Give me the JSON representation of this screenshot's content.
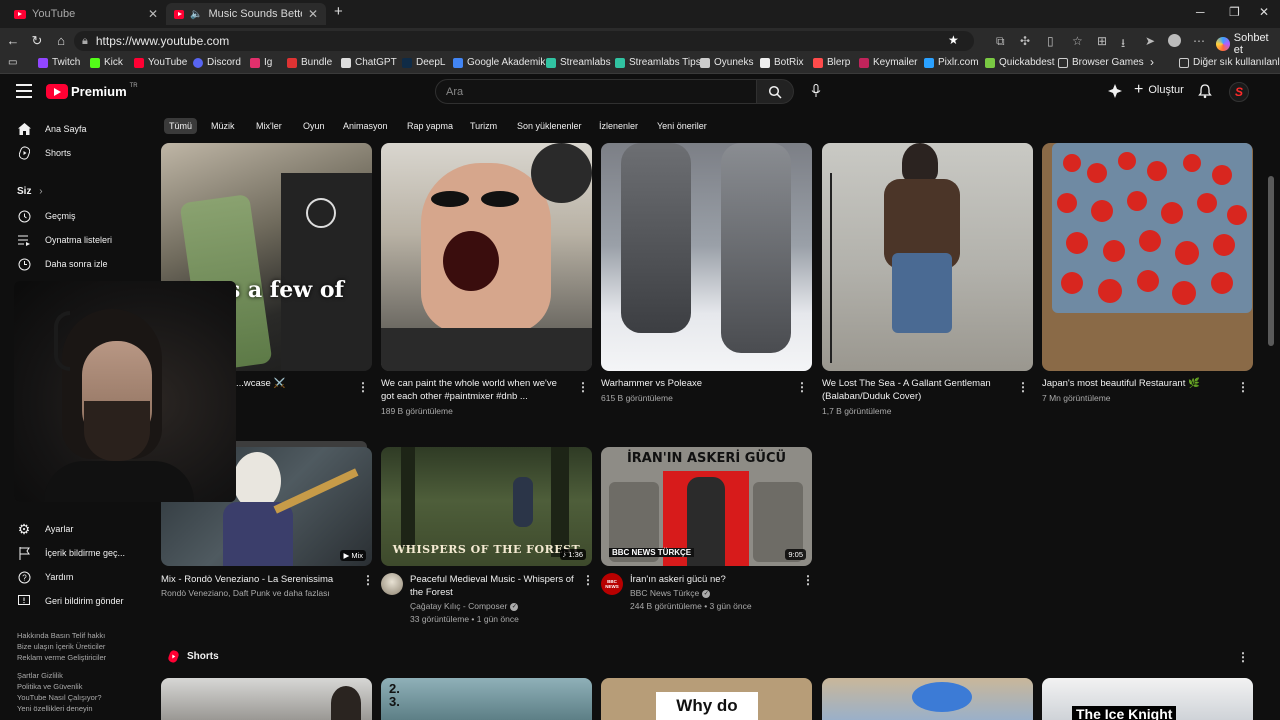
{
  "browser": {
    "tabs": [
      {
        "title": "YouTube",
        "active": false
      },
      {
        "title": "Music Sounds Better With Yo",
        "active": true
      }
    ],
    "url": "https://www.youtube.com",
    "copilot_label": "Sohbet et",
    "bookmarks": [
      "Twitch",
      "Kick",
      "YouTube",
      "Discord",
      "Ig",
      "Bundle",
      "ChatGPT",
      "DeepL",
      "Google Akademik",
      "Streamlabs",
      "Streamlabs Tips",
      "Oyuneks",
      "BotRix",
      "Blerp",
      "Keymailer",
      "Pixlr.com",
      "Quickabdest",
      "Browser Games"
    ],
    "other_bookmarks": "Diğer sık kullanılanlar"
  },
  "yt": {
    "logo_text": "Premium",
    "logo_region": "TR",
    "search_placeholder": "Ara",
    "create_label": "Oluştur",
    "avatar_letter": "S"
  },
  "sidebar": {
    "top": [
      {
        "label": "Ana Sayfa",
        "icon": "home-icon"
      },
      {
        "label": "Shorts",
        "icon": "shorts-icon"
      }
    ],
    "you_label": "Siz",
    "you_items": [
      {
        "label": "Geçmiş",
        "icon": "history-icon"
      },
      {
        "label": "Oynatma listeleri",
        "icon": "playlist-icon"
      },
      {
        "label": "Daha sonra izle",
        "icon": "clock-icon"
      }
    ],
    "bottom": [
      {
        "label": "Ayarlar",
        "icon": "gear-icon"
      },
      {
        "label": "İçerik bildirme geç...",
        "icon": "flag-icon"
      },
      {
        "label": "Yardım",
        "icon": "help-icon"
      },
      {
        "label": "Geri bildirim gönder",
        "icon": "feedback-icon"
      }
    ],
    "footer": [
      "Hakkında  Basın  Telif hakkı",
      "Bize ulaşın  İçerik Üreticiler",
      "Reklam verme  Geliştiriciler",
      "Şartlar  Gizlilik",
      "Politika ve Güvenlik",
      "YouTube Nasıl Çalışıyor?",
      "Yeni özellikleri deneyin"
    ]
  },
  "chips": [
    "Tümü",
    "Müzik",
    "Mix'ler",
    "Oyun",
    "Animasyon",
    "Rap yapma",
    "Turizm",
    "Son yüklenenler",
    "İzlenenler",
    "Yeni öneriler"
  ],
  "row1": [
    {
      "title": "...wcase ⚔️",
      "title2": "",
      "meta": "",
      "overlay": "s a few of"
    },
    {
      "title": "We can paint the whole world when we've",
      "title2": "got each other #paintmixer #dnb ...",
      "meta": "189 B görüntüleme",
      "overlay": ""
    },
    {
      "title": "Warhammer vs Poleaxe",
      "title2": "",
      "meta": "615 B görüntüleme",
      "overlay": ""
    },
    {
      "title": "We Lost The Sea - A Gallant Gentleman",
      "title2": "(Balaban/Duduk Cover)",
      "meta": "1,7 B görüntüleme",
      "overlay": ""
    },
    {
      "title": "Japan's most beautiful Restaurant 🌿",
      "title2": "",
      "meta": "7 Mn görüntüleme",
      "overlay": ""
    }
  ],
  "row2": [
    {
      "title": "Mix - Rondò Veneziano - La Serenissima",
      "title2": "",
      "channel": "Rondò Veneziano, Daft Punk ve daha fazlası",
      "meta": "",
      "badge": "Mix"
    },
    {
      "title": "Peaceful Medieval Music - Whispers of",
      "title2": "the Forest",
      "channel": "Çağatay Kılıç - Composer",
      "meta": "33 görüntüleme • 1 gün önce",
      "badge": "1:36",
      "thumb_text": "WHISPERS OF THE FOREST"
    },
    {
      "title": "İran'ın askeri gücü ne?",
      "title2": "",
      "channel": "BBC News Türkçe",
      "meta": "244 B görüntüleme • 3 gün önce",
      "badge": "9:05",
      "thumb_text": "İRAN'IN ASKERİ GÜCÜ",
      "thumb_logo": "BBC NEWS TÜRKÇE",
      "avatar_text": "BBC NEWS"
    }
  ],
  "shorts": {
    "label": "Shorts",
    "thumb_texts": [
      "",
      "2. 3.",
      "Why do",
      "",
      "The Ice Knight"
    ]
  }
}
